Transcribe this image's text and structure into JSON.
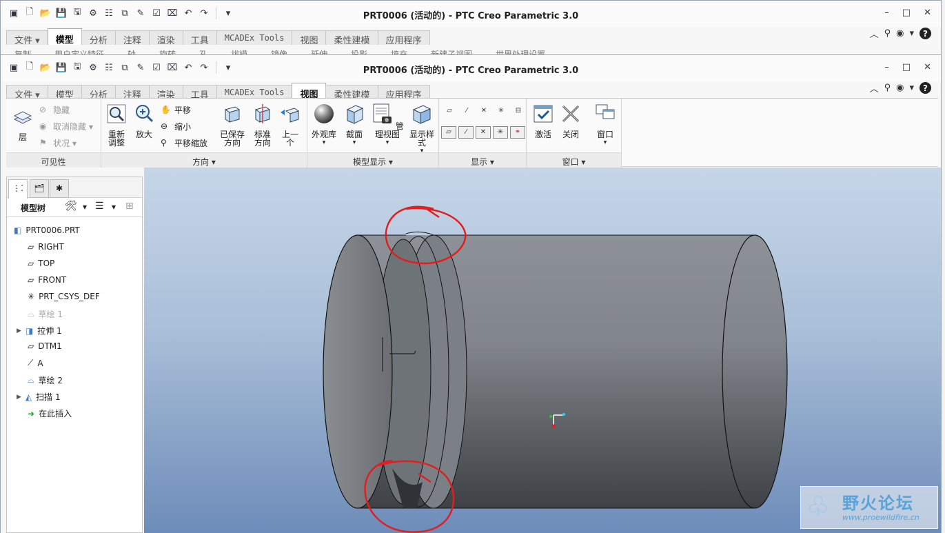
{
  "window": {
    "title": "PRT0006 (活动的) - PTC Creo Parametric 3.0",
    "controls": [
      "–",
      "□",
      "✕"
    ]
  },
  "quick_access": [
    "new",
    "open",
    "save",
    "save-copy",
    "regenerate",
    "regenerate-manager",
    "window-switch",
    "edit",
    "verify",
    "close",
    "undo",
    "redo",
    "customize"
  ],
  "tabs": [
    {
      "label": "文件",
      "dropdown": "▾"
    },
    {
      "label": "模型"
    },
    {
      "label": "分析"
    },
    {
      "label": "注释"
    },
    {
      "label": "渲染"
    },
    {
      "label": "工具"
    },
    {
      "label": "MCADEx Tools"
    },
    {
      "label": "视图"
    },
    {
      "label": "柔性建模"
    },
    {
      "label": "应用程序"
    }
  ],
  "back_active_tab": "模型",
  "front_active_tab": "视图",
  "back_ribbon_peek": [
    "复制",
    "用户定义特征",
    "轴",
    "旋转",
    "孔",
    "拔模",
    "镜像",
    "延伸",
    "投影",
    "填充",
    "新建子视图",
    "世界处理设置"
  ],
  "ribbon": {
    "visibility": {
      "label": "可见性",
      "layer": "层",
      "hide": "隐藏",
      "unhide": "取消隐藏",
      "status": "状况"
    },
    "orientation": {
      "label": "方向",
      "refit": "重新调整",
      "zoom_in": "放大",
      "pan": "平移",
      "zoom_out": "缩小",
      "pan_zoom": "平移缩放",
      "saved_orient": "已保存方向",
      "standard_orient": "标准方向",
      "previous": "上一个"
    },
    "model_display": {
      "label": "模型显示",
      "appearance": "外观库",
      "section": "截面",
      "manage_views": "管理视图",
      "display_style": "显示样式"
    },
    "show": {
      "label": "显示"
    },
    "window": {
      "label": "窗口",
      "activate": "激活",
      "close": "关闭",
      "windows": "窗口"
    }
  },
  "model_tree": {
    "title": "模型树",
    "items": [
      {
        "label": "PRT0006.PRT",
        "icon": "part-icon"
      },
      {
        "label": "RIGHT",
        "icon": "datum-plane-icon"
      },
      {
        "label": "TOP",
        "icon": "datum-plane-icon"
      },
      {
        "label": "FRONT",
        "icon": "datum-plane-icon"
      },
      {
        "label": "PRT_CSYS_DEF",
        "icon": "csys-icon"
      },
      {
        "label": "草绘 1",
        "icon": "sketch-icon",
        "disabled": true
      },
      {
        "label": "拉伸 1",
        "icon": "extrude-icon",
        "expandable": true
      },
      {
        "label": "DTM1",
        "icon": "datum-plane-icon"
      },
      {
        "label": "A",
        "icon": "datum-axis-icon"
      },
      {
        "label": "草绘 2",
        "icon": "sketch-icon"
      },
      {
        "label": "扫描 1",
        "icon": "sweep-icon",
        "expandable": true
      },
      {
        "label": "在此插入",
        "icon": "insert-here-icon"
      }
    ]
  },
  "watermark": {
    "title": "野火论坛",
    "url": "www.proewildfire.cn"
  },
  "colors": {
    "annotation_red": "#e02020",
    "model_gray": "#7d8187",
    "viewport_top": "#c6d6e8",
    "viewport_bottom": "#6d8cb9"
  }
}
